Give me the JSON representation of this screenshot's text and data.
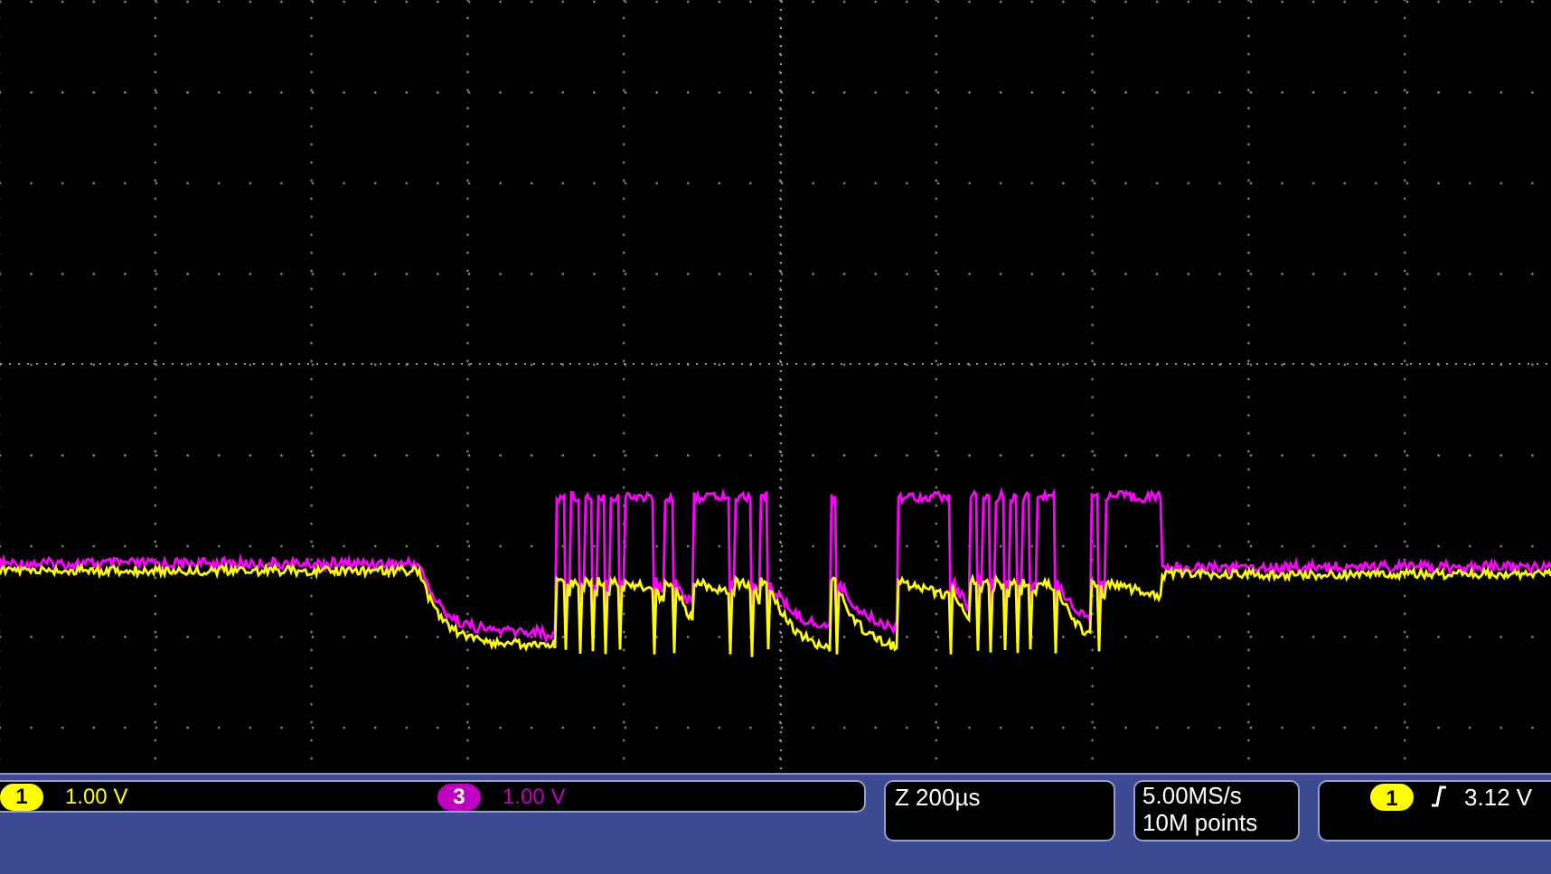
{
  "channels": [
    {
      "badge": "1",
      "scale": "1.00 V",
      "color": "#ffff00"
    },
    {
      "badge": "3",
      "scale": "1.00 V",
      "color": "#c000c0"
    }
  ],
  "horizontal": {
    "scale": "Z 200µs"
  },
  "acquisition": {
    "sample_rate": "5.00MS/s",
    "record_length": "10M points"
  },
  "trigger": {
    "source_badge": "1",
    "level": "3.12 V"
  }
}
